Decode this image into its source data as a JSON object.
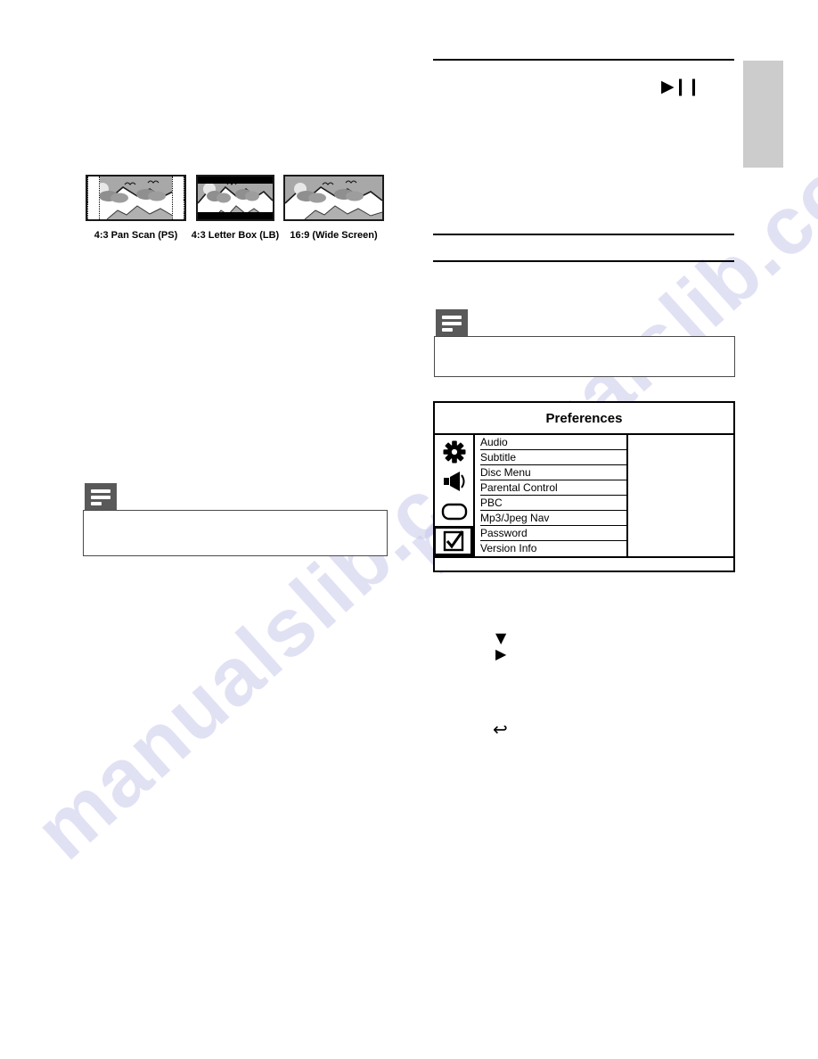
{
  "document": {
    "watermark_text": "manualslib.com"
  },
  "chapter_tab": {
    "label": ""
  },
  "figure_aspect_ratios": {
    "items": [
      {
        "caption": "4:3 Pan Scan (PS)",
        "icon": "tv-pan-scan-thumbnail"
      },
      {
        "caption": "4:3 Letter Box (LB)",
        "icon": "tv-letter-box-thumbnail"
      },
      {
        "caption": "16:9 (Wide Screen)",
        "icon": "tv-wide-screen-thumbnail"
      }
    ]
  },
  "notes": {
    "left": {
      "icon": "note-icon",
      "text": ""
    },
    "right": {
      "icon": "note-icon",
      "text": ""
    }
  },
  "osd": {
    "title": "Preferences",
    "icons": [
      {
        "name": "gear-icon",
        "selected": false
      },
      {
        "name": "speaker-icon",
        "selected": false
      },
      {
        "name": "video-icon",
        "selected": false
      },
      {
        "name": "checkbox-icon",
        "selected": true
      }
    ],
    "items": [
      {
        "label": "Audio",
        "value": ""
      },
      {
        "label": "Subtitle",
        "value": ""
      },
      {
        "label": "Disc Menu",
        "value": ""
      },
      {
        "label": "Parental Control",
        "value": ""
      },
      {
        "label": "PBC",
        "value": ""
      },
      {
        "label": "Mp3/Jpeg Nav",
        "value": ""
      },
      {
        "label": "Password",
        "value": ""
      },
      {
        "label": "Version Info",
        "value": ""
      }
    ]
  },
  "glyphs": {
    "play_pause": "▶❙❙",
    "nav_down": "▼",
    "nav_right": "▶",
    "back": "↩"
  },
  "colors": {
    "tab_gray": "#cccccc",
    "note_icon_gray": "#595959",
    "rule_black": "#000000",
    "watermark": "#c9c9ec"
  }
}
